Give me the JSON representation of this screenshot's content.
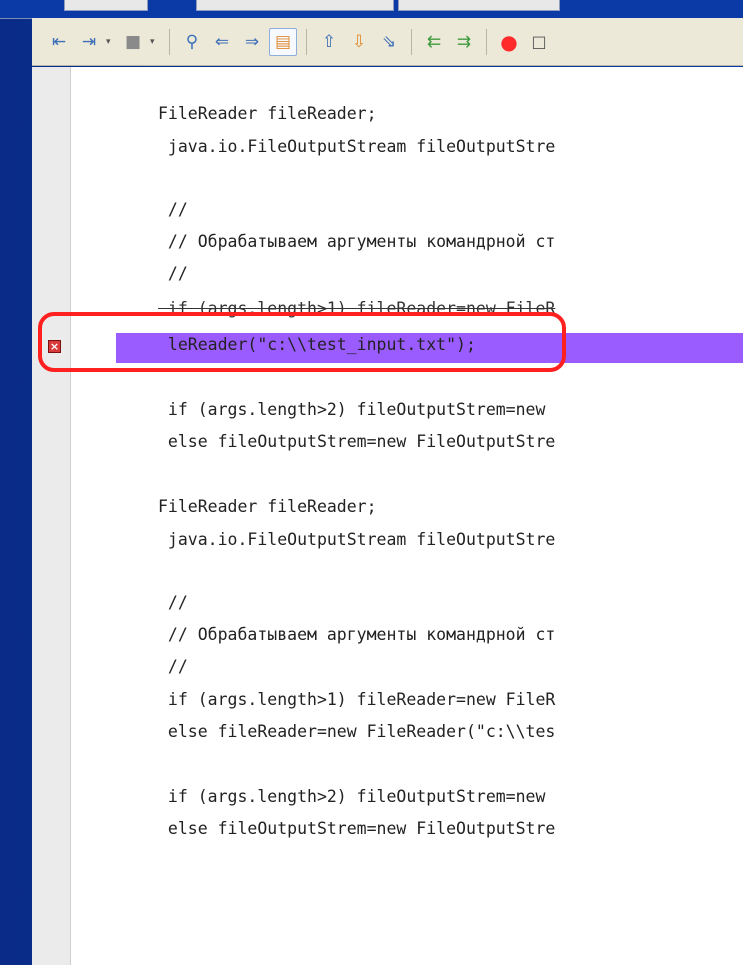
{
  "toolbar": {
    "buttons": [
      {
        "icon": "back-icon",
        "glyph": "⇤"
      },
      {
        "icon": "forward-history-icon",
        "glyph": "⇥"
      },
      {
        "icon": "bookmark-icon",
        "glyph": "■"
      },
      {
        "icon": "find-icon",
        "glyph": "⚲"
      },
      {
        "icon": "find-previous-icon",
        "glyph": "⇐"
      },
      {
        "icon": "find-next-icon",
        "glyph": "⇒"
      },
      {
        "icon": "toggle-highlight-icon",
        "glyph": "▤"
      },
      {
        "icon": "previous-bookmark-icon",
        "glyph": "⇧"
      },
      {
        "icon": "next-bookmark-icon",
        "glyph": "⇩"
      },
      {
        "icon": "toggle-bookmark-icon",
        "glyph": "⇘"
      },
      {
        "icon": "shift-left-icon",
        "glyph": "⇇"
      },
      {
        "icon": "shift-right-icon",
        "glyph": "⇉"
      },
      {
        "icon": "record-macro-icon",
        "glyph": "●"
      },
      {
        "icon": "stop-macro-icon",
        "glyph": "□"
      }
    ]
  },
  "code": {
    "lines": [
      "FileReader fileReader;",
      " java.io.FileOutputStream fileOutputStre",
      " //",
      " // Обрабатываем аргументы командрной ст",
      " //",
      " if (args.length>1) fileReader=new FileR",
      " leReader(\"c:\\\\test_input.txt\");",
      " if (args.length>2) fileOutputStrem=new ",
      " else fileOutputStrem=new FileOutputStre",
      "FileReader fileReader;",
      " java.io.FileOutputStream fileOutputStre",
      " //",
      " // Обрабатываем аргументы командрной ст",
      " //",
      " if (args.length>1) fileReader=new FileR",
      " else fileReader=new FileReader(\"c:\\\\tes",
      " if (args.length>2) fileOutputStrem=new ",
      " else fileOutputStrem=new FileOutputStre"
    ]
  },
  "colors": {
    "highlight": "#9b5cff",
    "callout": "#ff2020",
    "error": "#d83a3a",
    "background": "#0b3aa6"
  }
}
